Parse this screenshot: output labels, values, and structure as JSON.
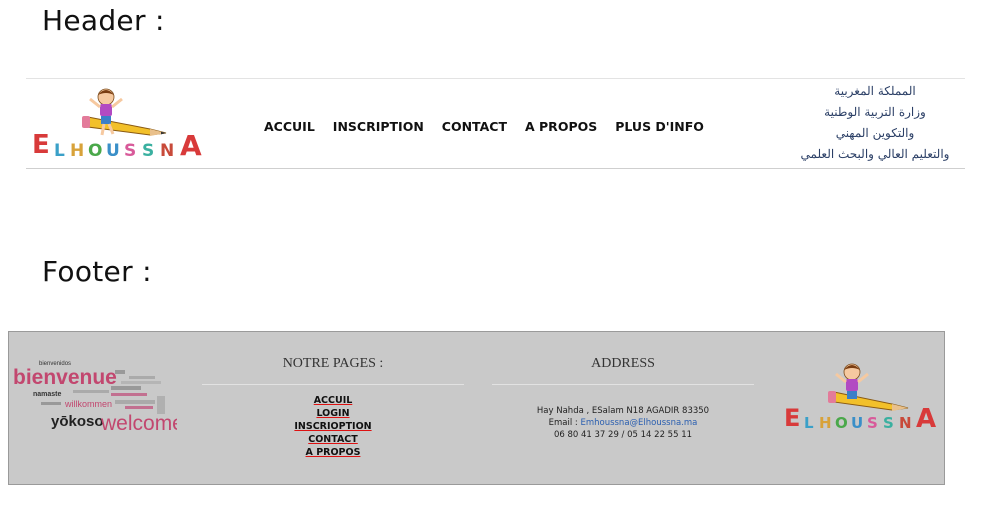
{
  "labels": {
    "header": "Header :",
    "footer": "Footer :"
  },
  "logo": {
    "text": "ELHOUSSNA",
    "icon": "child-on-pencil-logo"
  },
  "header": {
    "nav": [
      "ACCUIL",
      "INSCRIPTION",
      "CONTACT",
      "A PROPOS",
      "PLUS D'INFO"
    ],
    "ministry_lines": [
      "المملكة المغربية",
      "وزارة التربية الوطنية",
      "والتكوين المهني",
      "والتعليم العالي والبحث العلمي"
    ]
  },
  "footer": {
    "word_cloud": {
      "words": [
        "bienvenidos",
        "bienvenue",
        "namaste",
        "willkommen",
        "yōkoso",
        "welcome"
      ],
      "icon": "welcome-word-cloud"
    },
    "pages_title": "NOTRE PAGES :",
    "links": [
      "ACCUIL",
      "LOGIN",
      "INSCRIOPTION",
      "CONTACT",
      "A PROPOS"
    ],
    "address_title": "ADDRESS",
    "address_line": "Hay Nahda , ESalam N18 AGADIR 83350",
    "email_label": "Email : ",
    "email": "Emhoussna@Elhoussna.ma",
    "phones": "06 80 41 37 29 / 05 14 22 55 11"
  },
  "colors": {
    "footer_bg": "#c9c9c9",
    "arabic_text": "#2b3f66",
    "link_underline": "#dd1111"
  }
}
